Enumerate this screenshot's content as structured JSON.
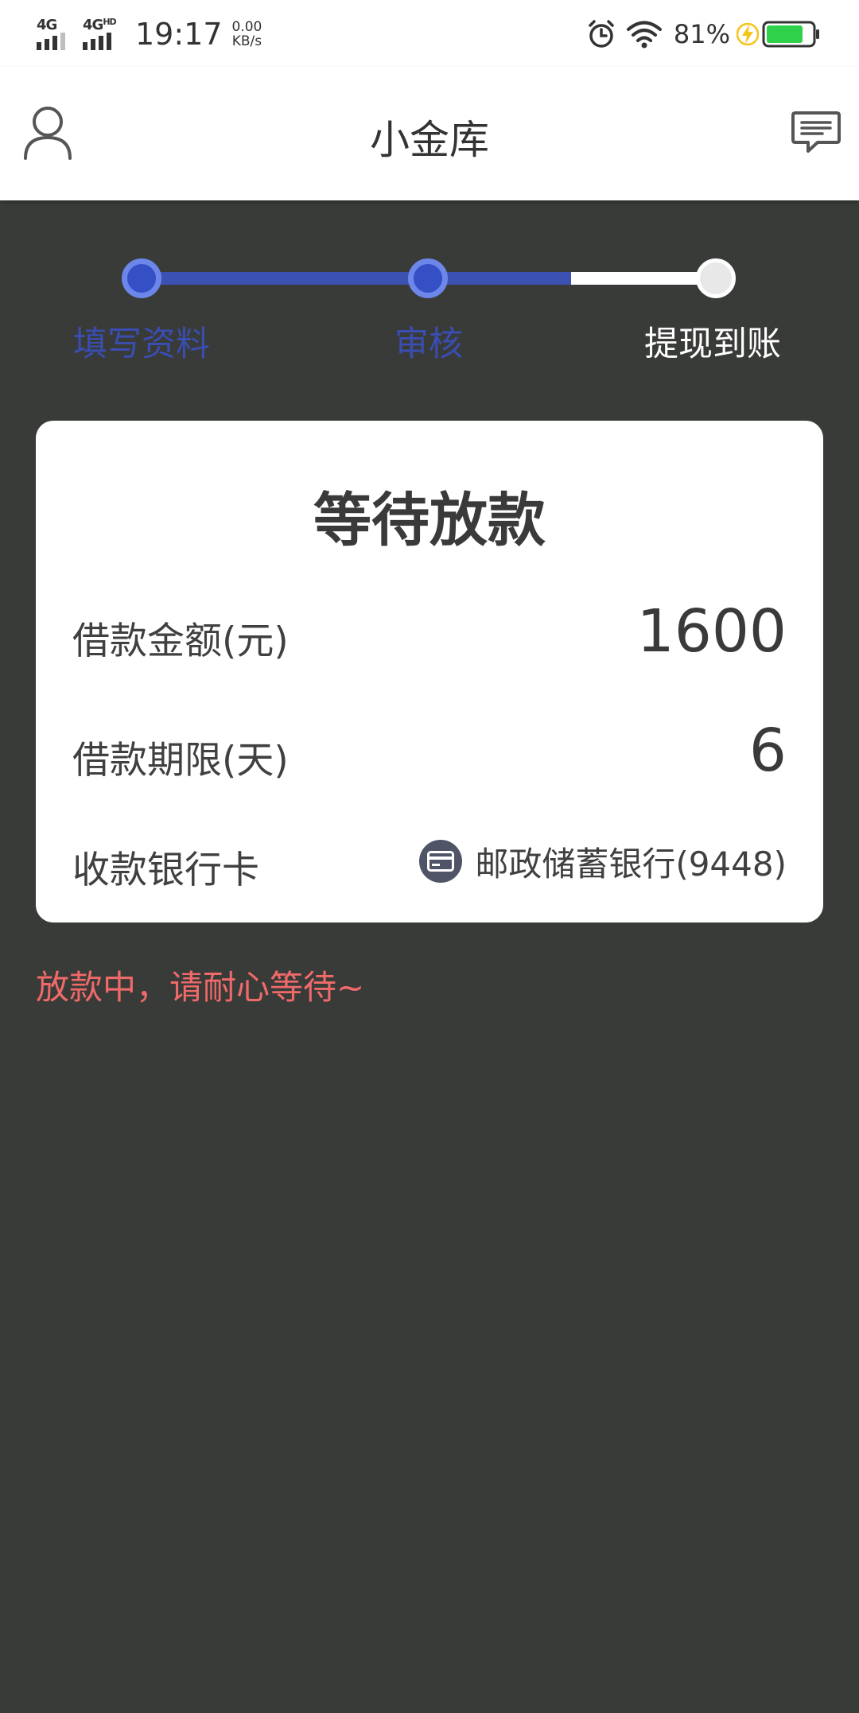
{
  "status_bar": {
    "network_1": "4G",
    "network_2": "4G",
    "network_2_suffix": "HD",
    "time": "19:17",
    "speed_value": "0.00",
    "speed_unit": "KB/s",
    "battery_percent": "81%",
    "battery_level": 81,
    "battery_color": "#2fd04a",
    "charging_color": "#f5c518"
  },
  "header": {
    "title": "小金库",
    "left_icon": "person-icon",
    "right_icon": "message-icon"
  },
  "steps": {
    "items": [
      {
        "label": "填写资料",
        "state": "done"
      },
      {
        "label": "审核",
        "state": "done"
      },
      {
        "label": "提现到账",
        "state": "todo"
      }
    ],
    "active_color": "#3450c4",
    "inactive_color": "#ffffff"
  },
  "card": {
    "title": "等待放款",
    "amount_label": "借款金额(元)",
    "amount_value": "1600",
    "term_label": "借款期限(天)",
    "term_value": "6",
    "bank_label": "收款银行卡",
    "bank_icon": "bank-card-icon",
    "bank_value": "邮政储蓄银行(9448)"
  },
  "notice": {
    "text": "放款中，请耐心等待~",
    "color": "#f06a6a"
  }
}
